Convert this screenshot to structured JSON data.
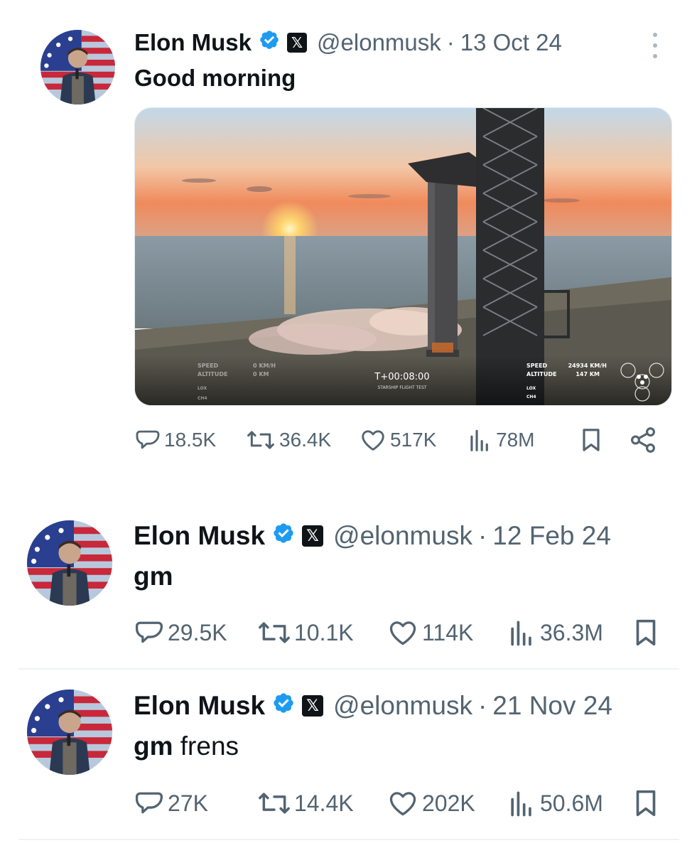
{
  "tweets": [
    {
      "author": "Elon Musk",
      "handle": "@elonmusk",
      "separator": "·",
      "date": "13 Oct 24",
      "text_bold": "Good morning",
      "text_regular": "",
      "media": {
        "overlay": {
          "left_speed_label": "SPEED",
          "left_altitude_label": "ALTITUDE",
          "left_speed_value": "0 KM/H",
          "left_altitude_value": "0 KM",
          "left_lox": "LOX",
          "left_ch4": "CH4",
          "timer": "T+00:08:00",
          "mission": "STARSHIP FLIGHT TEST",
          "right_speed_label": "SPEED",
          "right_speed_value": "24934 KM/H",
          "right_altitude_label": "ALTITUDE",
          "right_altitude_value": "147 KM",
          "right_lox": "LOX",
          "right_ch4": "CH4"
        }
      },
      "stats": {
        "replies": "18.5K",
        "reposts": "36.4K",
        "likes": "517K",
        "views": "78M"
      }
    },
    {
      "author": "Elon Musk",
      "handle": "@elonmusk",
      "separator": "·",
      "date": "12 Feb 24",
      "text_bold": "gm",
      "text_regular": "",
      "stats": {
        "replies": "29.5K",
        "reposts": "10.1K",
        "likes": "114K",
        "views": "36.3M"
      }
    },
    {
      "author": "Elon Musk",
      "handle": "@elonmusk",
      "separator": "·",
      "date": "21 Nov 24",
      "text_bold": "gm",
      "text_regular": " frens",
      "stats": {
        "replies": "27K",
        "reposts": "14.4K",
        "likes": "202K",
        "views": "50.6M"
      }
    }
  ],
  "icons": {
    "reply": "speech-bubble-icon",
    "repost": "repost-arrows-icon",
    "like": "heart-icon",
    "views": "bar-chart-icon",
    "bookmark": "bookmark-icon",
    "share": "share-icon",
    "verified": "verified-badge-icon",
    "x_logo": "x-logo-icon",
    "more": "more-vertical-icon"
  },
  "colors": {
    "text": "#0f1419",
    "secondary": "#536471",
    "verified": "#1d9bf0",
    "divider": "#eff3f4"
  }
}
